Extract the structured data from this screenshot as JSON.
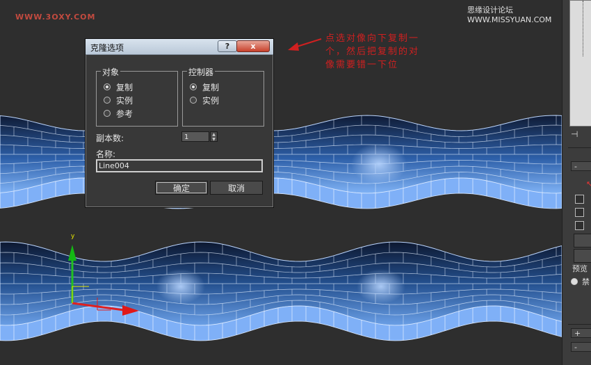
{
  "watermarks": {
    "top_left": "WWW.3OXY.COM",
    "top_right": "思缘设计论坛 WWW.MISSYUAN.COM"
  },
  "annotation": "点选对像向下复制一个，然后把复制的对像需要错一下位",
  "gizmo": {
    "axis_label": "y"
  },
  "dialog": {
    "title": "克隆选项",
    "help_label": "?",
    "close_label": "x",
    "object_group": {
      "label": "对象",
      "options": [
        "复制",
        "实例",
        "参考"
      ],
      "selected": "复制"
    },
    "controller_group": {
      "label": "控制器",
      "options": [
        "复制",
        "实例"
      ],
      "selected": "复制"
    },
    "copies_label": "副本数:",
    "copies_value": "1",
    "name_label": "名称:",
    "name_value": "Line004",
    "ok_label": "确定",
    "cancel_label": "取消"
  },
  "right_panel": {
    "rollout_minus": "-",
    "rollout_plus": "+",
    "rollout_minus2": "-",
    "preview_label": "预览",
    "radio_label": "禁",
    "pin_icon": "pin-icon"
  },
  "colors": {
    "mesh": "#5b8fe0",
    "mesh_dark": "#0e1a33",
    "annotation": "#d02020",
    "viewport_bg": "#2e2e2e"
  }
}
